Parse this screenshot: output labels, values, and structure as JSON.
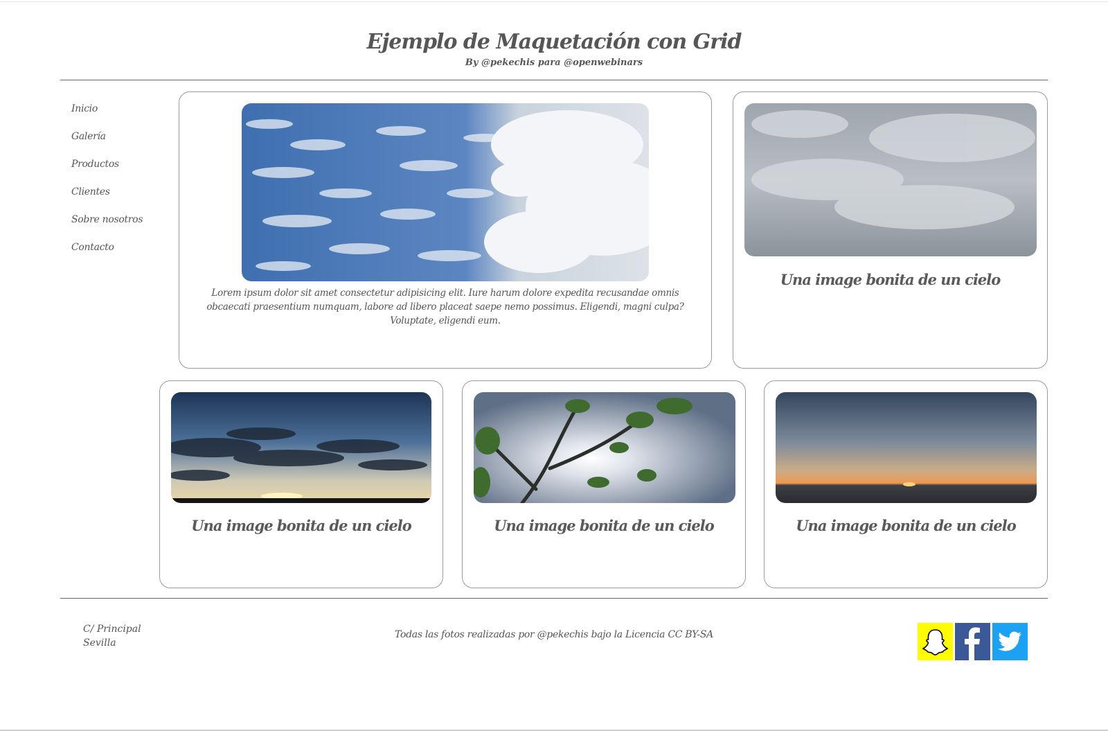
{
  "header": {
    "title": "Ejemplo de Maquetación con Grid",
    "subtitle": "By @pekechis para @openwebinars"
  },
  "nav": {
    "items": [
      {
        "label": "Inicio"
      },
      {
        "label": "Galería"
      },
      {
        "label": "Productos"
      },
      {
        "label": "Clientes"
      },
      {
        "label": "Sobre nosotros"
      },
      {
        "label": "Contacto"
      }
    ]
  },
  "main": {
    "featured": {
      "text": "Lorem ipsum dolor sit amet consectetur adipisicing elit. Iure harum dolore expedita recusandae omnis obcaecati praesentium numquam, labore ad libero placeat saepe nemo possimus. Eligendi, magni culpa? Voluptate, eligendi eum.",
      "image": "blue-sky-clouds"
    },
    "cards": [
      {
        "caption": "Una image bonita de un cielo",
        "image": "overcast-sky"
      },
      {
        "caption": "Una image bonita de un cielo",
        "image": "sunset-clouds"
      },
      {
        "caption": "Una image bonita de un cielo",
        "image": "tree-branches-sun"
      },
      {
        "caption": "Una image bonita de un cielo",
        "image": "sea-sunset"
      }
    ]
  },
  "footer": {
    "address_line1": "C/ Principal",
    "address_line2": "Sevilla",
    "credits": "Todas las fotos realizadas por @pekechis bajo la Licencia CC BY-SA",
    "social": [
      {
        "name": "snapchat-icon",
        "color": "#fffc00"
      },
      {
        "name": "facebook-icon",
        "color": "#3b5998"
      },
      {
        "name": "twitter-icon",
        "color": "#1da1f2"
      }
    ]
  },
  "colors": {
    "text": "#555555",
    "border": "#9a9a9a",
    "rule": "#666666"
  }
}
